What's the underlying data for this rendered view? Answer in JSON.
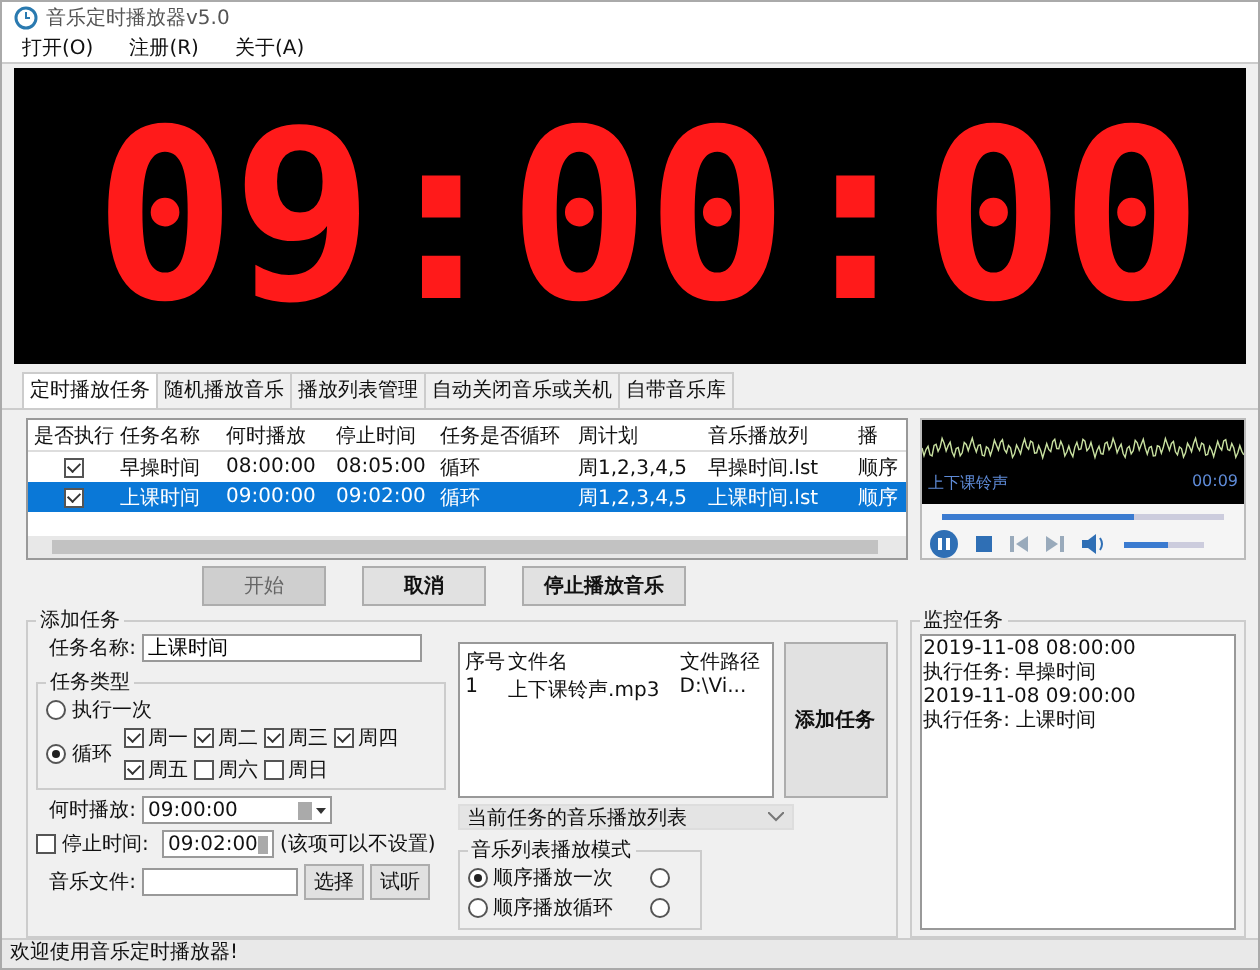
{
  "window": {
    "title": "音乐定时播放器v5.0"
  },
  "menu": [
    {
      "label": "打开(O)"
    },
    {
      "label": "注册(R)"
    },
    {
      "label": "关于(A)"
    }
  ],
  "clock": {
    "time": "09:00:00"
  },
  "tabs": [
    {
      "label": "定时播放任务",
      "selected": true
    },
    {
      "label": "随机播放音乐",
      "selected": false
    },
    {
      "label": "播放列表管理",
      "selected": false
    },
    {
      "label": "自动关闭音乐或关机",
      "selected": false
    },
    {
      "label": "自带音乐库",
      "selected": false
    }
  ],
  "task_table": {
    "columns": [
      "是否执行",
      "任务名称",
      "何时播放",
      "停止时间",
      "任务是否循环",
      "周计划",
      "音乐播放列",
      "播"
    ],
    "rows": [
      {
        "checked": true,
        "selected": false,
        "cells": [
          "",
          "早操时间",
          "08:00:00",
          "08:05:00",
          "循环",
          "周1,2,3,4,5",
          "早操时间.lst",
          "顺序"
        ]
      },
      {
        "checked": true,
        "selected": true,
        "cells": [
          "",
          "上课时间",
          "09:00:00",
          "09:02:00",
          "循环",
          "周1,2,3,4,5",
          "上课时间.lst",
          "顺序"
        ]
      }
    ]
  },
  "player": {
    "track": "上下课铃声",
    "time": "00:09",
    "progress": {
      "level": 0.68
    },
    "volume": {
      "level": 0.55
    }
  },
  "buttons": [
    {
      "label": "开始",
      "disabled": true
    },
    {
      "label": "取消",
      "disabled": false
    },
    {
      "label": "停止播放音乐",
      "disabled": false
    }
  ],
  "add_task": {
    "title": "添加任务",
    "name_label": "任务名称:",
    "name_value": "上课时间",
    "type_group": {
      "title": "任务类型",
      "options": [
        {
          "label": "执行一次",
          "selected": false
        },
        {
          "label": "循环",
          "selected": true
        }
      ],
      "days": [
        {
          "label": "周一",
          "checked": true
        },
        {
          "label": "周二",
          "checked": true
        },
        {
          "label": "周三",
          "checked": true
        },
        {
          "label": "周四",
          "checked": true
        },
        {
          "label": "周五",
          "checked": true
        },
        {
          "label": "周六",
          "checked": false
        },
        {
          "label": "周日",
          "checked": false
        }
      ]
    },
    "start_label": "何时播放:",
    "start_value": "09:00:00",
    "stop": {
      "label": "停止时间:",
      "checked": false,
      "value": "09:02:00",
      "note": "(该项可以不设置)"
    },
    "file_label": "音乐文件:",
    "file_buttons": [
      "选择",
      "试听"
    ]
  },
  "file_list": {
    "columns": [
      "序号",
      "文件名",
      "文件路径"
    ],
    "rows": [
      [
        "1",
        "上下课铃声.mp3",
        "D:\\Vi..."
      ]
    ]
  },
  "add_button": "添加任务",
  "playlist_dropdown": "当前任务的音乐播放列表",
  "play_mode": {
    "title": "音乐列表播放模式",
    "options": [
      {
        "label": "顺序播放一次",
        "selected": true
      },
      {
        "label": "顺序播放循环",
        "selected": false
      },
      {
        "selected": false
      },
      {
        "selected": false
      }
    ]
  },
  "monitor": {
    "title": "监控任务",
    "lines": [
      "2019-11-08 08:00:00",
      "执行任务: 早操时间",
      "2019-11-08 09:00:00",
      "执行任务: 上课时间"
    ]
  },
  "status_bar": "欢迎使用音乐定时播放器!"
}
